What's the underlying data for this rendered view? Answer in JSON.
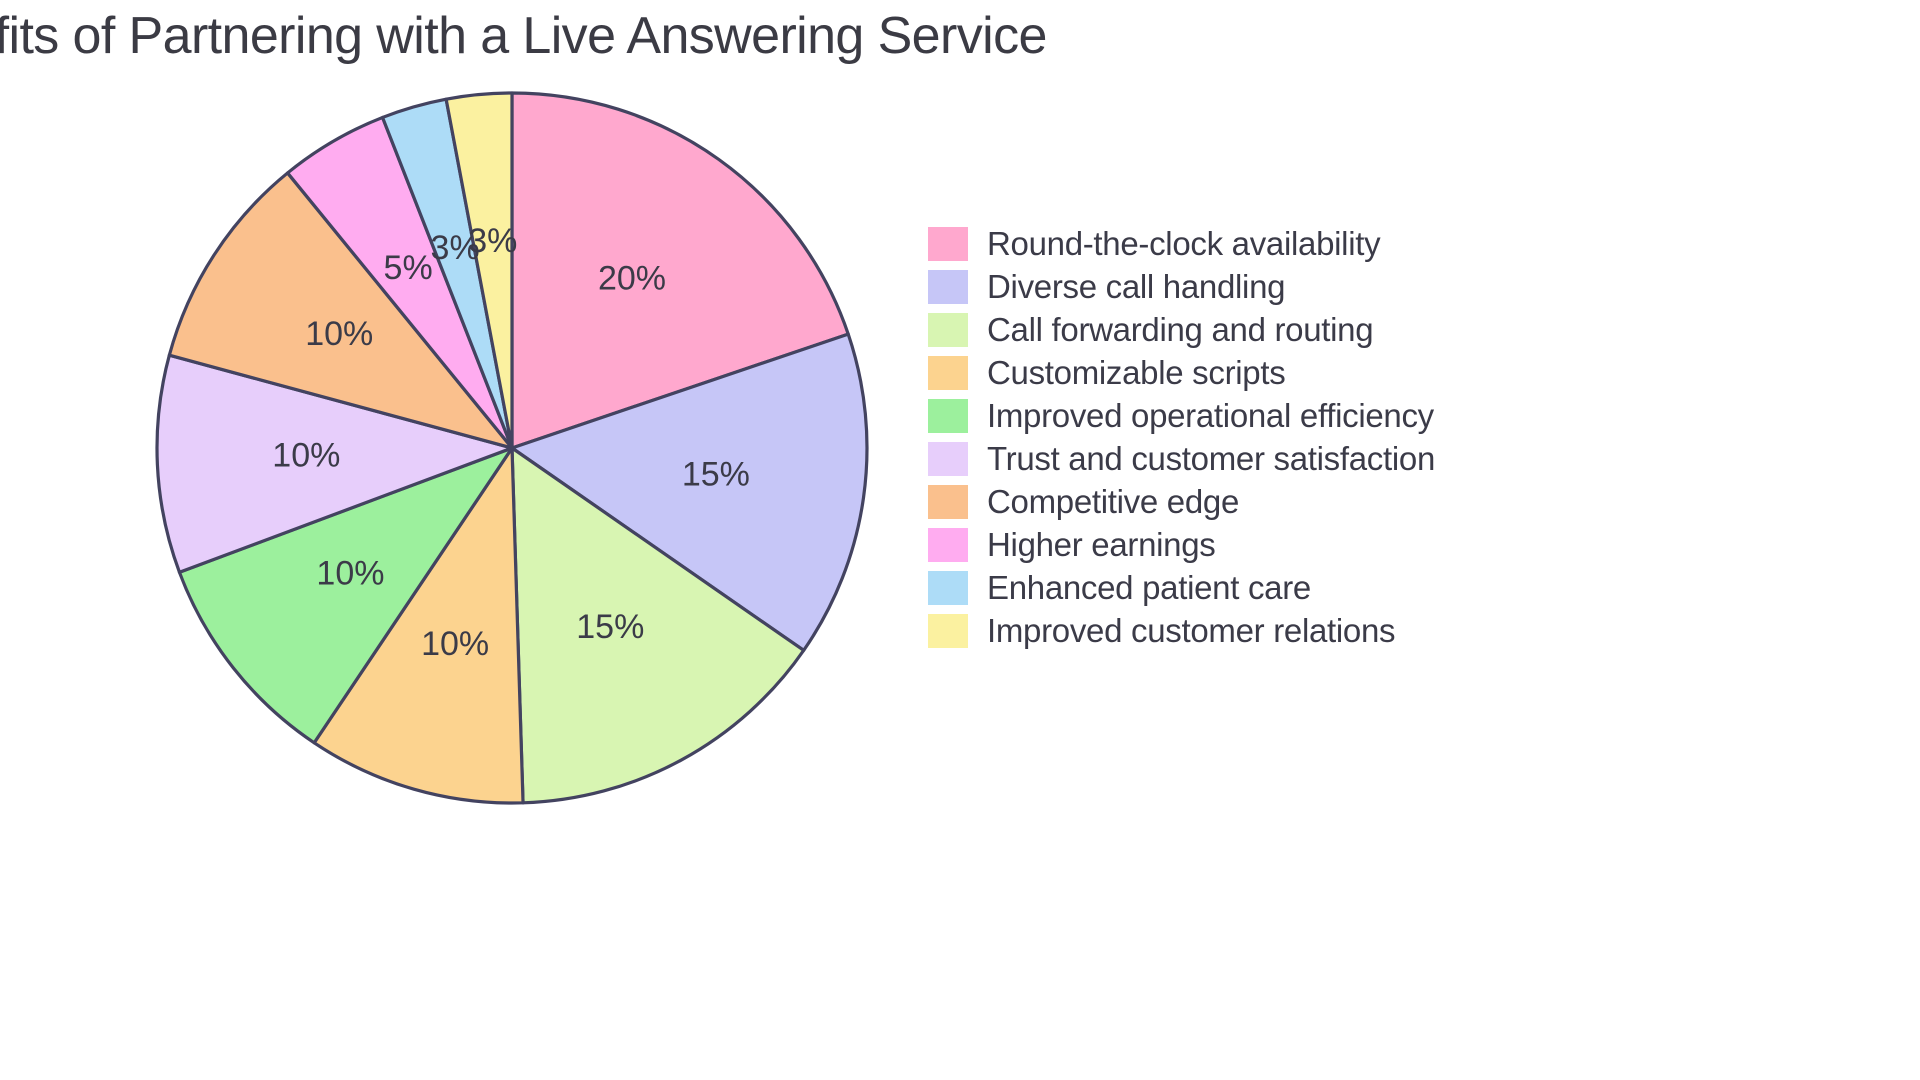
{
  "chart_data": {
    "type": "pie",
    "title": "nefits of Partnering with a Live Answering Service",
    "title_full_visible": "nefits of Partnering with a Live Answering Service",
    "xlabel": "",
    "ylabel": "",
    "legend_position": "right",
    "grid": false,
    "start_angle_deg": 90,
    "direction": "clockwise",
    "labels": [
      "Round-the-clock availability",
      "Diverse call handling",
      "Call forwarding and routing",
      "Customizable scripts",
      "Improved operational efficiency",
      "Trust and customer satisfaction",
      "Competitive edge",
      "Higher earnings",
      "Enhanced patient care",
      "Improved customer relations"
    ],
    "values": [
      20,
      15,
      15,
      10,
      10,
      10,
      10,
      5,
      3,
      3
    ],
    "value_labels": [
      "20%",
      "15%",
      "15%",
      "10%",
      "10%",
      "10%",
      "10%",
      "5%",
      "3%",
      "3%"
    ],
    "colors": [
      "#FFA8CE",
      "#C6C6F7",
      "#D8F5B2",
      "#FCD38F",
      "#9CF09D",
      "#E7CEFB",
      "#FAC08D",
      "#FFACF0",
      "#ADDCF7",
      "#FBF1A0"
    ],
    "slice_edge_color": "#434360",
    "text_color": "#3b3b48",
    "background_color": "#FFFFFF"
  },
  "legend": {
    "items": [
      {
        "label": "Round-the-clock availability",
        "color": "#FFA8CE"
      },
      {
        "label": "Diverse call handling",
        "color": "#C6C6F7"
      },
      {
        "label": "Call forwarding and routing",
        "color": "#D8F5B2"
      },
      {
        "label": "Customizable scripts",
        "color": "#FCD38F"
      },
      {
        "label": "Improved operational efficiency",
        "color": "#9CF09D"
      },
      {
        "label": "Trust and customer satisfaction",
        "color": "#E7CEFB"
      },
      {
        "label": "Competitive edge",
        "color": "#FAC08D"
      },
      {
        "label": "Higher earnings",
        "color": "#FFACF0"
      },
      {
        "label": "Enhanced patient care",
        "color": "#ADDCF7"
      },
      {
        "label": "Improved customer relations",
        "color": "#FBF1A0"
      }
    ]
  }
}
